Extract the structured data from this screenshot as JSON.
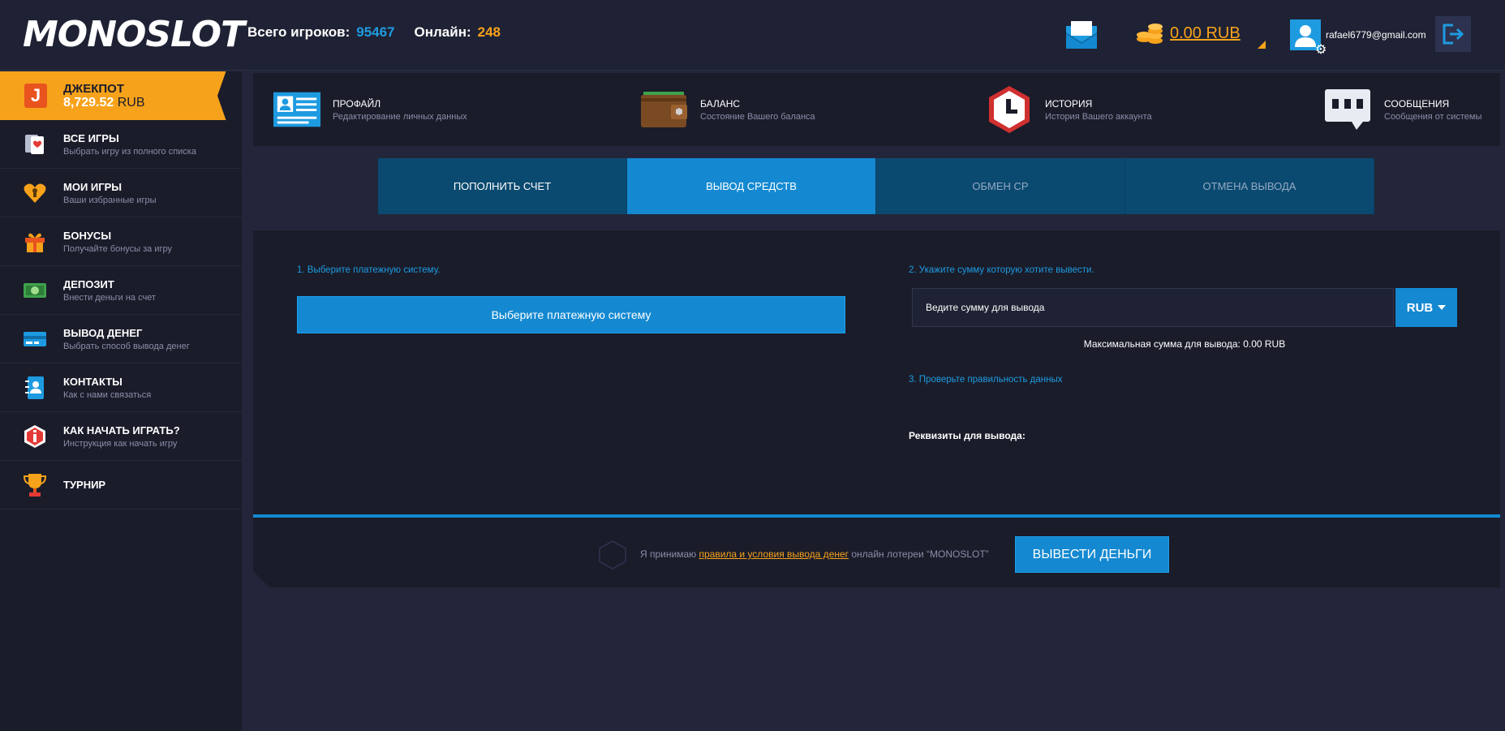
{
  "header": {
    "logo": "MONOSLOT",
    "total_players_label": "Всего игроков:",
    "total_players_value": "95467",
    "online_label": "Онлайн:",
    "online_value": "248",
    "balance": "0.00 RUB",
    "email": "rafael6779@gmail.com"
  },
  "sidebar": {
    "jackpot": {
      "title": "ДЖЕКПОТ",
      "amount": "8,729.52",
      "currency": "RUB",
      "icon_letter": "J"
    },
    "items": [
      {
        "title": "ВСЕ ИГРЫ",
        "subtitle": "Выбрать игру из полного списка",
        "icon": "cards-icon"
      },
      {
        "title": "МОИ ИГРЫ",
        "subtitle": "Ваши избранные игры",
        "icon": "heart-icon"
      },
      {
        "title": "БОНУСЫ",
        "subtitle": "Получайте бонусы за игру",
        "icon": "gift-icon"
      },
      {
        "title": "ДЕПОЗИТ",
        "subtitle": "Внести деньги на счет",
        "icon": "money-icon"
      },
      {
        "title": "ВЫВОД ДЕНЕГ",
        "subtitle": "Выбрать способ вывода денег",
        "icon": "credit-card-icon"
      },
      {
        "title": "КОНТАКТЫ",
        "subtitle": "Как с нами связаться",
        "icon": "contacts-icon"
      },
      {
        "title": "КАК НАЧАТЬ ИГРАТЬ?",
        "subtitle": "Инструкция как начать игру",
        "icon": "info-icon"
      },
      {
        "title": "ТУРНИР",
        "subtitle": "",
        "icon": "trophy-icon"
      }
    ]
  },
  "cards": [
    {
      "title": "ПРОФАЙЛ",
      "subtitle": "Редактирование личных данных",
      "icon": "profile-card-icon"
    },
    {
      "title": "БАЛАНС",
      "subtitle": "Состояние Вашего баланса",
      "icon": "wallet-icon"
    },
    {
      "title": "ИСТОРИЯ",
      "subtitle": "История Вашего аккаунта",
      "icon": "clock-icon"
    },
    {
      "title": "СООБЩЕНИЯ",
      "subtitle": "Сообщения от системы",
      "icon": "chat-icon"
    }
  ],
  "tabs": [
    {
      "label": "ПОПОЛНИТЬ СЧЕТ"
    },
    {
      "label": "ВЫВОД СРЕДСТВ"
    },
    {
      "label": "ОБМЕН СР"
    },
    {
      "label": "ОТМЕНА ВЫВОДА"
    }
  ],
  "withdraw": {
    "step1": "1. Выберите платежную систему.",
    "select_button": "Выберите платежную систему",
    "step2": "2. Укажите сумму которую хотите вывести.",
    "amount_placeholder": "Ведите сумму для вывода",
    "currency": "RUB",
    "max_sum": "Максимальная сумма для вывода: 0.00 RUB",
    "step3": "3. Проверьте правильность данных",
    "requisites": "Реквизиты для вывода:",
    "accept_prefix": "Я принимаю ",
    "accept_link": "правила и условия вывода денег",
    "accept_suffix": " онлайн лотереи “MONOSLOT”",
    "submit": "ВЫВЕСТИ ДЕНЬГИ"
  },
  "colors": {
    "accent": "#1489d1",
    "brand": "#f7a21b",
    "bg": "#23263a",
    "panel": "#1a1c2a"
  }
}
